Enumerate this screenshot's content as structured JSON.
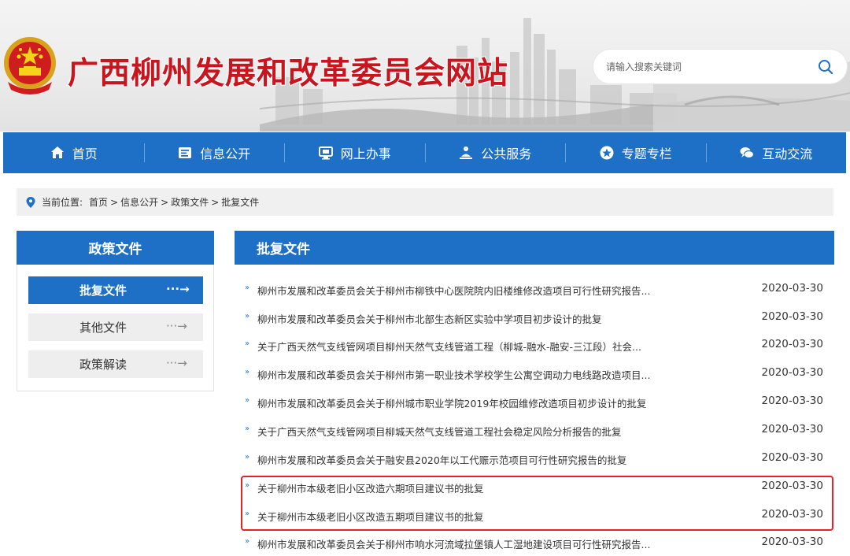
{
  "header": {
    "title": "广西柳州发展和改革委员会网站",
    "search_placeholder": "请输入搜索关键词",
    "search_icon": "search-icon",
    "emblem_icon": "national-emblem-icon"
  },
  "nav": {
    "items": [
      {
        "label": "首页",
        "icon": "home-icon"
      },
      {
        "label": "信息公开",
        "icon": "info-icon"
      },
      {
        "label": "网上办事",
        "icon": "monitor-icon"
      },
      {
        "label": "公共服务",
        "icon": "service-icon"
      },
      {
        "label": "专题专栏",
        "icon": "star-icon"
      },
      {
        "label": "互动交流",
        "icon": "chat-icon"
      }
    ]
  },
  "breadcrumb": {
    "prefix": "当前位置:",
    "items": [
      "首页",
      "信息公开",
      "政策文件",
      "批复文件"
    ],
    "separator": ">"
  },
  "sidebar": {
    "title": "政策文件",
    "items": [
      {
        "label": "批复文件",
        "arrow": "···→",
        "active": true
      },
      {
        "label": "其他文件",
        "arrow": "···→",
        "active": false
      },
      {
        "label": "政策解读",
        "arrow": "···→",
        "active": false
      }
    ]
  },
  "main": {
    "title": "批复文件",
    "bullet": "»",
    "rows": [
      {
        "title": "柳州市发展和改革委员会关于柳州市柳铁中心医院院内旧楼维修改造项目可行性研究报告...",
        "date": "2020-03-30"
      },
      {
        "title": "柳州市发展和改革委员会关于柳州市北部生态新区实验中学项目初步设计的批复",
        "date": "2020-03-30"
      },
      {
        "title": "关于广西天然气支线管网项目柳州天然气支线管道工程（柳城-融水-融安-三江段）社会...",
        "date": "2020-03-30"
      },
      {
        "title": "柳州市发展和改革委员会关于柳州市第一职业技术学校学生公寓空调动力电线路改造项目...",
        "date": "2020-03-30"
      },
      {
        "title": "柳州市发展和改革委员会关于柳州城市职业学院2019年校园维修改造项目初步设计的批复",
        "date": "2020-03-30"
      },
      {
        "title": "关于广西天然气支线管网项目柳城天然气支线管道工程社会稳定风险分析报告的批复",
        "date": "2020-03-30"
      },
      {
        "title": "柳州市发展和改革委员会关于融安县2020年以工代赈示范项目可行性研究报告的批复",
        "date": "2020-03-30"
      },
      {
        "title": "关于柳州市本级老旧小区改造六期项目建议书的批复",
        "date": "2020-03-30"
      },
      {
        "title": "关于柳州市本级老旧小区改造五期项目建议书的批复",
        "date": "2020-03-30"
      },
      {
        "title": "柳州市发展和改革委员会关于柳州市响水河流域拉堡镇人工湿地建设项目可行性研究报告...",
        "date": "2020-03-30"
      }
    ]
  },
  "colors": {
    "primary": "#1e70c6",
    "title_red": "#c9151e",
    "highlight_red": "#e8202a"
  }
}
